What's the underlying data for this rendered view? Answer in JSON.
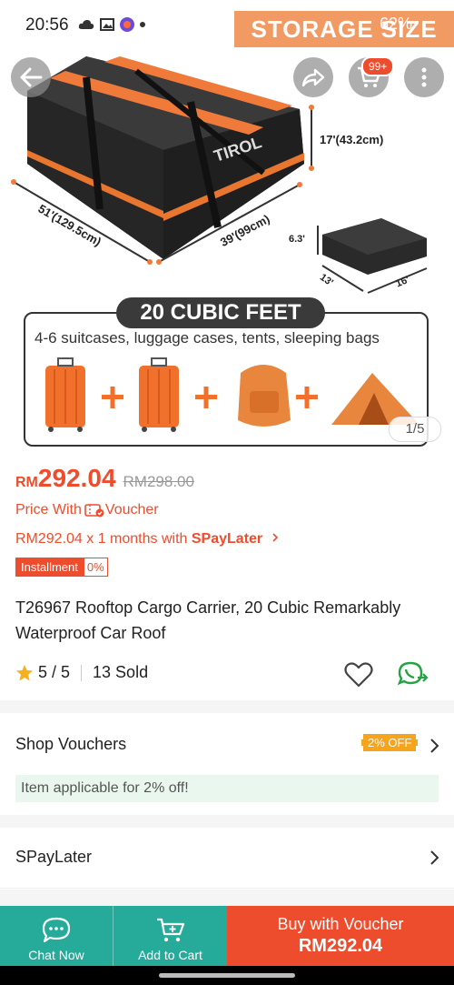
{
  "status_bar": {
    "time": "20:56",
    "battery": "62%",
    "overlay_banner": "STORAGE SIZE"
  },
  "hero": {
    "brand_logo": "TIROL",
    "dimensions": {
      "height": "17'(43.2cm)",
      "length": "51'(129.5cm)",
      "width": "39'(99cm)",
      "folded_h": "6.3'",
      "folded_l": "13'",
      "folded_w": "16'"
    },
    "capacity_title": "20 CUBIC FEET",
    "capacity_sub": "4-6 suitcases, luggage cases, tents, sleeping bags",
    "image_counter": "1/5",
    "cart_badge": "99+"
  },
  "price": {
    "currency": "RM",
    "value": "292.04",
    "original": "RM298.00",
    "voucher_prefix": "Price With",
    "voucher_word": "Voucher",
    "installment_line_prefix": "RM292.04 x 1 months with ",
    "installment_line_brand": "SPayLater",
    "installment_tag": "Installment",
    "installment_pct": "0%"
  },
  "product": {
    "title": "T26967 Rooftop Cargo Carrier, 20 Cubic Remarkably Waterproof Car Roof",
    "rating": "5 / 5",
    "sold": "13 Sold"
  },
  "sections": {
    "shop_vouchers": "Shop Vouchers",
    "shop_vouchers_badge": "2% OFF",
    "applicable_note": "Item applicable for 2% off!",
    "spaylater": "SPayLater"
  },
  "bottom_bar": {
    "chat_label": "Chat Now",
    "cart_label": "Add to Cart",
    "buy_label": "Buy with Voucher",
    "buy_price": "RM292.04"
  },
  "colors": {
    "accent": "#ee4d2d",
    "teal": "#26aa99",
    "orange_strap": "#f07a3a"
  }
}
